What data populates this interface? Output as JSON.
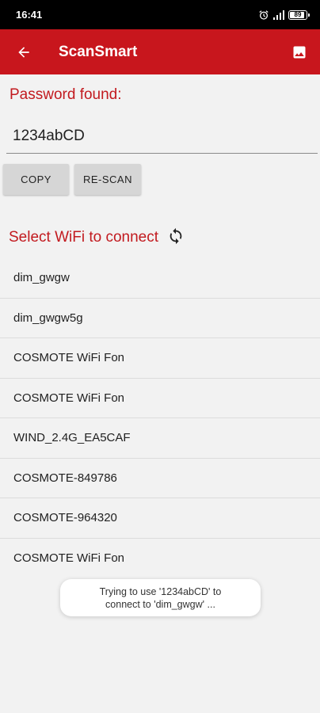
{
  "status_bar": {
    "time": "16:41",
    "battery_level": "89",
    "icons": [
      "alarm-icon",
      "signal-icon",
      "battery-icon"
    ]
  },
  "app_bar": {
    "title": "ScanSmart",
    "back_icon": "arrow-back-icon",
    "image_icon": "image-icon",
    "color": "#c8161d"
  },
  "password": {
    "label": "Password found:",
    "value": "1234abCD"
  },
  "buttons": {
    "copy": "COPY",
    "rescan": "RE-SCAN"
  },
  "wifi": {
    "title": "Select WiFi to connect",
    "refresh_icon": "refresh-icon",
    "networks": [
      "dim_gwgw",
      "dim_gwgw5g",
      "COSMOTE WiFi Fon",
      "COSMOTE WiFi Fon",
      "WIND_2.4G_EA5CAF",
      "COSMOTE-849786",
      "COSMOTE-964320",
      "COSMOTE WiFi Fon"
    ]
  },
  "toast": {
    "line1": "Trying to use '1234abCD' to",
    "line2": "connect to 'dim_gwgw' ..."
  },
  "colors": {
    "accent": "#c21a1f",
    "background": "#f2f2f2",
    "button": "#d6d6d6"
  }
}
